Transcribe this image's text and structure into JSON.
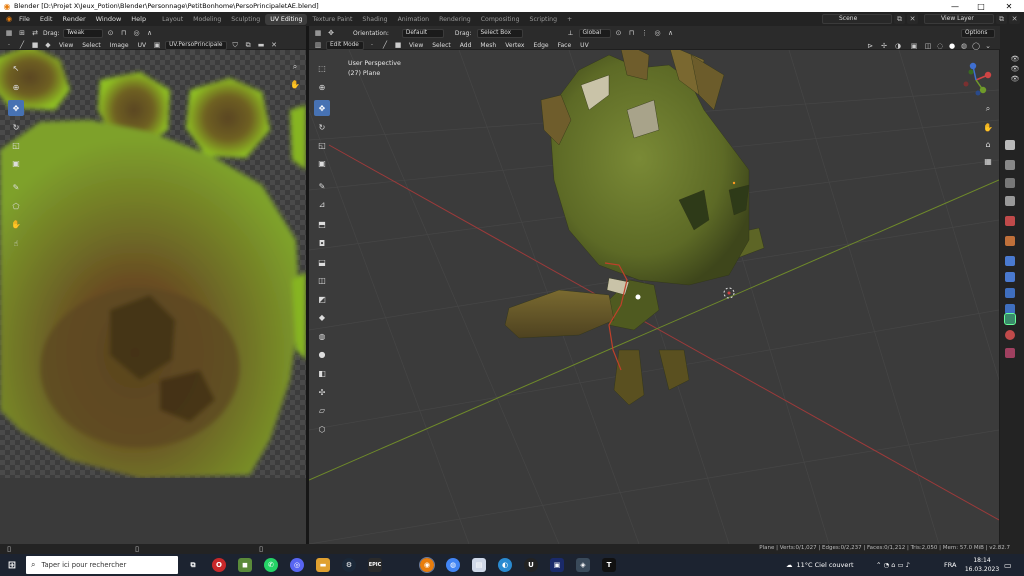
{
  "window": {
    "title": "Blender [D:\\Projet X\\Jeux_Potion\\Blender\\Personnage\\PetitBonhome\\PersoPrincipaletAE.blend]",
    "minimize": "—",
    "maximize": "□",
    "close": "✕"
  },
  "menu": [
    "File",
    "Edit",
    "Render",
    "Window",
    "Help"
  ],
  "workspaces": [
    {
      "label": "Layout",
      "active": false
    },
    {
      "label": "Modeling",
      "active": false
    },
    {
      "label": "Sculpting",
      "active": false
    },
    {
      "label": "UV Editing",
      "active": true
    },
    {
      "label": "Texture Paint",
      "active": false
    },
    {
      "label": "Shading",
      "active": false
    },
    {
      "label": "Animation",
      "active": false
    },
    {
      "label": "Rendering",
      "active": false
    },
    {
      "label": "Compositing",
      "active": false
    },
    {
      "label": "Scripting",
      "active": false
    }
  ],
  "add_workspace": "+",
  "scene": {
    "value": "Scene"
  },
  "view_layer": {
    "value": "View Layer"
  },
  "uv_editor": {
    "drag_label": "Drag:",
    "drag_value": "Tweak",
    "menus": [
      "View",
      "Select",
      "Image",
      "UV"
    ],
    "image_name": "UV.PersoPrincipale"
  },
  "viewport": {
    "mode": "Edit Mode",
    "orientation_label": "Orientation:",
    "orientation_value": "Default",
    "drag_label": "Drag:",
    "drag_value": "Select Box",
    "menus": [
      "View",
      "Select",
      "Add",
      "Mesh",
      "Vertex",
      "Edge",
      "Face",
      "UV"
    ],
    "transform_orientation": "Global",
    "options": "Options",
    "perspective": "User Perspective",
    "object": "(27) Plane",
    "gizmo": {
      "x": "X",
      "y": "Y",
      "z": "Z"
    }
  },
  "status": {
    "text": "Plane | Verts:0/1,027 | Edges:0/2,237 | Faces:0/1,212 | Tris:2,050 | Mem: 57.0 MiB | v2.82.7"
  },
  "taskbar": {
    "search_placeholder": "Taper ici pour rechercher",
    "weather": "11°C  Ciel couvert",
    "lang": "FRA",
    "time": "18:14",
    "date": "16.03.2023"
  },
  "colors": {
    "accent": "#4772b3",
    "uv_green": "#7ea12a",
    "mesh_green": "#6e7b2e"
  }
}
